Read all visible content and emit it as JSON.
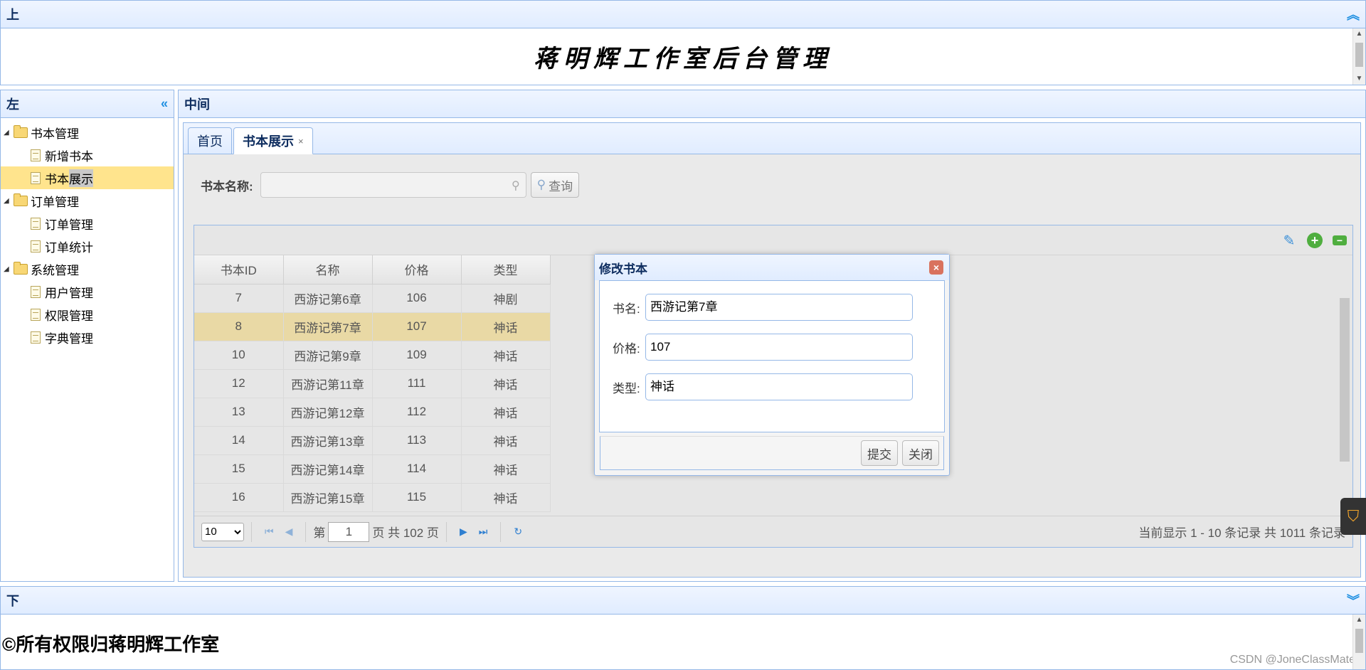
{
  "north": {
    "title": "上",
    "collapse_icon": "double-chevron-up",
    "site_title": "蒋明辉工作室后台管理"
  },
  "west": {
    "title": "左",
    "collapse_icon": "double-chevron-left",
    "tree": [
      {
        "label": "书本管理",
        "children": [
          "新增书本",
          "书本展示"
        ]
      },
      {
        "label": "订单管理",
        "children": [
          "订单管理",
          "订单统计"
        ]
      },
      {
        "label": "系统管理",
        "children": [
          "用户管理",
          "权限管理",
          "字典管理"
        ]
      }
    ],
    "selected_prefix": "书本",
    "selected_suffix": "展示"
  },
  "center": {
    "title": "中间",
    "tabs": [
      {
        "label": "首页"
      },
      {
        "label": "书本展示",
        "close": "×"
      }
    ],
    "search": {
      "label": "书本名称:",
      "placeholder": "",
      "button": "查询"
    },
    "grid": {
      "columns": [
        "书本ID",
        "名称",
        "价格",
        "类型"
      ],
      "rows": [
        [
          "7",
          "西游记第6章",
          "106",
          "神剧"
        ],
        [
          "8",
          "西游记第7章",
          "107",
          "神话"
        ],
        [
          "10",
          "西游记第9章",
          "109",
          "神话"
        ],
        [
          "12",
          "西游记第11章",
          "111",
          "神话"
        ],
        [
          "13",
          "西游记第12章",
          "112",
          "神话"
        ],
        [
          "14",
          "西游记第13章",
          "113",
          "神话"
        ],
        [
          "15",
          "西游记第14章",
          "114",
          "神话"
        ],
        [
          "16",
          "西游记第15章",
          "115",
          "神话"
        ]
      ],
      "selected_row_index": 1,
      "toolbar_icons": [
        "edit-icon",
        "add-icon",
        "remove-icon"
      ],
      "pager": {
        "page_size": "10",
        "page_label_before": "第",
        "page_value": "1",
        "page_label_after": "页 共 102 页",
        "info": "当前显示 1 - 10 条记录 共 1011 条记录"
      }
    }
  },
  "dialog": {
    "title": "修改书本",
    "fields": [
      {
        "label": "书名:",
        "value": "西游记第7章"
      },
      {
        "label": "价格:",
        "value": "107"
      },
      {
        "label": "类型:",
        "value": "神话"
      }
    ],
    "submit": "提交",
    "close": "关闭"
  },
  "south": {
    "title": "下",
    "collapse_icon": "double-chevron-down",
    "copyright": "©所有权限归蒋明辉工作室",
    "watermark": "CSDN @JoneClassMate"
  },
  "colors": {
    "border": "#95b8e7",
    "header_grad_top": "#eff5ff",
    "header_grad_bottom": "#e0ecff",
    "selected": "#ffe48d",
    "row_selected": "#e9d9a5"
  }
}
